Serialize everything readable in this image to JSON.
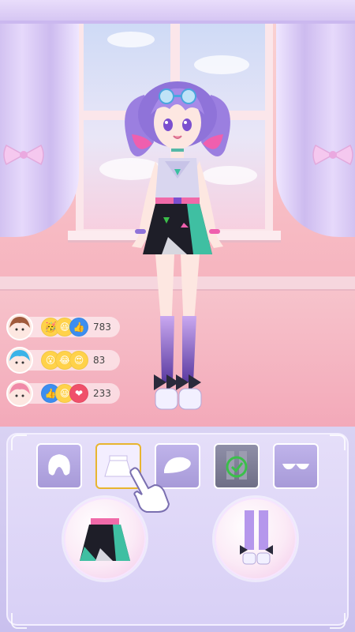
{
  "scene": {
    "colors": {
      "wall": "#f6b4bf",
      "panel": "#d8d0f6",
      "selected_border": "#e8b52f",
      "check_green": "#3bbf4a"
    }
  },
  "reactions": [
    {
      "avatar_icon": "girl-brown-hair-avatar",
      "emojis": [
        "party-face-icon",
        "laughing-face-icon",
        "thumbs-up-icon"
      ],
      "count": "783"
    },
    {
      "avatar_icon": "boy-blue-hair-avatar",
      "emojis": [
        "surprised-face-icon",
        "joy-face-icon",
        "heart-eyes-face-icon"
      ],
      "count": "83"
    },
    {
      "avatar_icon": "girl-pink-hair-avatar",
      "emojis": [
        "thumbs-up-icon",
        "laughing-face-icon",
        "heart-icon"
      ],
      "count": "233"
    }
  ],
  "category_tabs": [
    {
      "id": "hair",
      "icon": "hair-icon",
      "selected": false,
      "owned_check": false
    },
    {
      "id": "skirt",
      "icon": "skirt-icon",
      "selected": true,
      "owned_check": false
    },
    {
      "id": "hat",
      "icon": "beret-hat-icon",
      "selected": false,
      "owned_check": false
    },
    {
      "id": "stockings",
      "icon": "stockings-icon",
      "selected": false,
      "owned_check": true
    },
    {
      "id": "accessory",
      "icon": "glasses-icon",
      "selected": false,
      "owned_check": false
    }
  ],
  "item_options": [
    {
      "id": "skirt-black-teal",
      "icon": "skirt-item-icon"
    },
    {
      "id": "purple-socks-boots",
      "icon": "socks-boots-item-icon"
    }
  ],
  "tutorial": {
    "icon": "pointing-hand-icon"
  }
}
